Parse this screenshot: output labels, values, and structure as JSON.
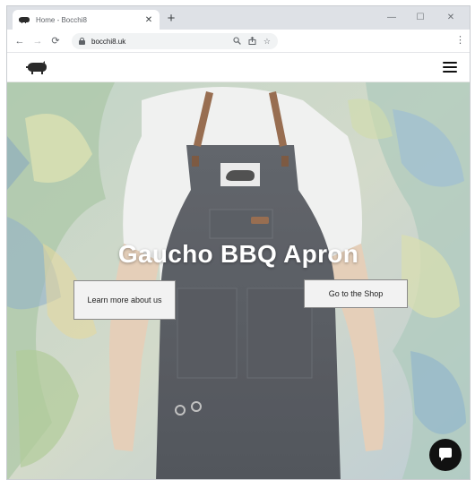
{
  "browser": {
    "tab_title": "Home - Bocchi8",
    "new_tab": "+",
    "tab_close": "✕",
    "url": "bocchi8.uk",
    "window_controls": {
      "minimize": "—",
      "maximize": "☐",
      "close": "✕"
    },
    "nav": {
      "back": "←",
      "forward": "→",
      "reload": "⟳"
    },
    "omnibox_icons": {
      "zoom": "🔍",
      "share": "⇪",
      "bookmark": "☆"
    },
    "menu": "⋮"
  },
  "site": {
    "logo_icon": "pig-logo-icon",
    "menu_icon": "hamburger-icon"
  },
  "hero": {
    "title": "Gaucho BBQ Apron",
    "learn_button": "Learn more about us",
    "shop_button": "Go to the Shop",
    "chat_icon": "chat-bubble-icon"
  },
  "colors": {
    "tabstrip": "#dee1e6",
    "hero_title": "#ffffff",
    "button_bg": "#f2f2f2",
    "chat_bg": "#111111"
  }
}
